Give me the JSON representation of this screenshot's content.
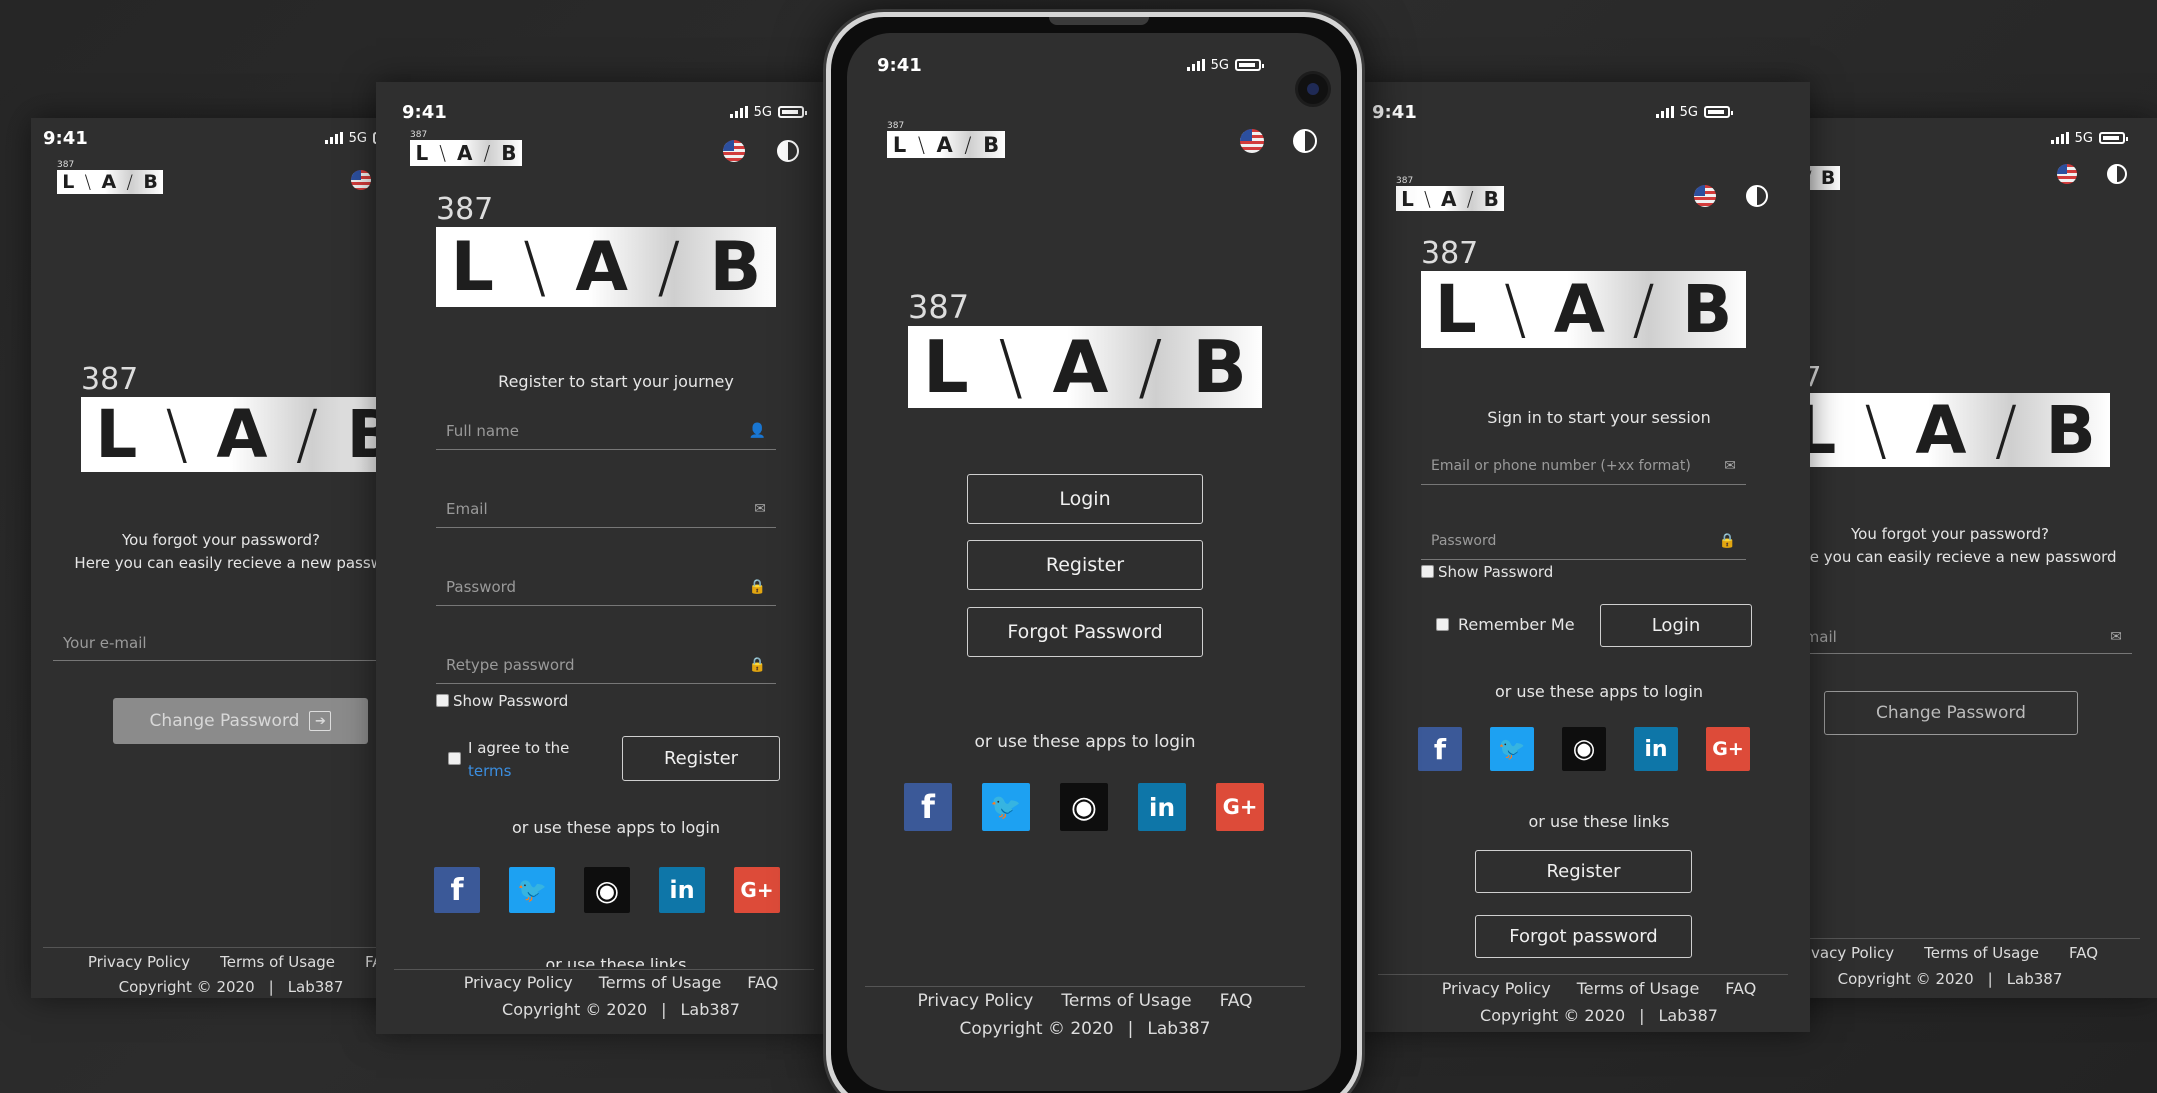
{
  "status": {
    "time": "9:41",
    "network": "5G"
  },
  "logo": {
    "number": "387",
    "letters": [
      "L",
      "A",
      "B"
    ]
  },
  "forgot_screen": {
    "title_line1": "You forgot your password?",
    "title_line2": "Here you can easily recieve a new password",
    "email_placeholder": "Your e-mail",
    "email_placeholder_short": "e-mail",
    "change_button": "Change Password"
  },
  "register_screen": {
    "title": "Register to start your journey",
    "fields": {
      "full_name": "Full name",
      "email": "Email",
      "password": "Password",
      "retype_password": "Retype password"
    },
    "show_password": "Show Password",
    "agree_text": "I agree to the",
    "terms_link": "terms",
    "register_button": "Register",
    "apps_label": "or use these apps to login",
    "links_label": "or use these links"
  },
  "main_screen": {
    "login_button": "Login",
    "register_button": "Register",
    "forgot_button": "Forgot Password",
    "apps_label": "or use these apps to login"
  },
  "signin_screen": {
    "title": "Sign in to start your session",
    "email_placeholder": "Email or phone number (+xx format)",
    "password_placeholder": "Password",
    "show_password": "Show Password",
    "remember_me": "Remember Me",
    "login_button": "Login",
    "apps_label": "or use these apps to login",
    "links_label": "or use these links",
    "register_button": "Register",
    "forgot_button": "Forgot password"
  },
  "social": {
    "facebook": "f",
    "twitter": "🐦",
    "github": "◉",
    "linkedin": "in",
    "google": "G+"
  },
  "footer": {
    "privacy": "Privacy Policy",
    "terms": "Terms of Usage",
    "faq": "FAQ",
    "copyright": "Copyright © 2020",
    "separator": "|",
    "brand": "Lab387"
  }
}
